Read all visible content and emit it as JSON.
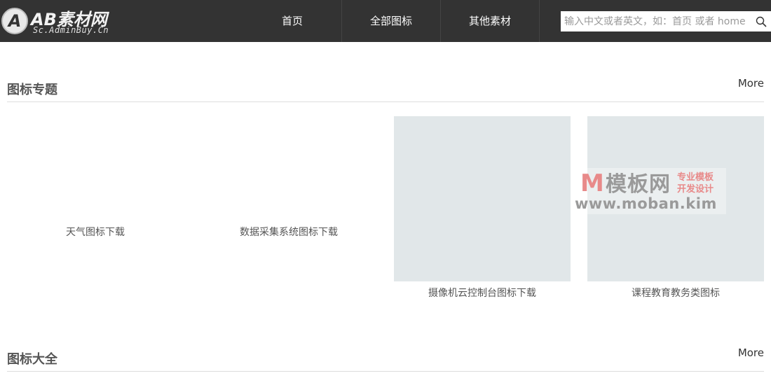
{
  "header": {
    "logo_mark": "A",
    "logo_title": "AB素材网",
    "logo_subtitle": "Sc.AdminBuy.Cn",
    "nav": [
      "首页",
      "全部图标",
      "其他素材"
    ],
    "search_placeholder": "输入中文或者英文，如：首页 或者 home",
    "search_icon": "magnifier-icon"
  },
  "sections": [
    {
      "title": "图标专题",
      "more": "More",
      "cards": [
        {
          "label": "天气图标下载",
          "thumb_loaded": false
        },
        {
          "label": "数据采集系统图标下载",
          "thumb_loaded": false
        },
        {
          "label": "摄像机云控制台图标下载",
          "thumb_loaded": true
        },
        {
          "label": "课程教育教务类图标",
          "thumb_loaded": true
        }
      ]
    },
    {
      "title": "图标大全",
      "more": "More"
    }
  ],
  "watermark": {
    "m": "M",
    "brand": "模板网",
    "tag1": "专业模板",
    "tag2": "开发设计",
    "url": "www.moban.kim"
  },
  "colors": {
    "header_bg": "#333333",
    "thumb_bg": "#e1e7e9",
    "watermark_red": "#e88a8a"
  }
}
